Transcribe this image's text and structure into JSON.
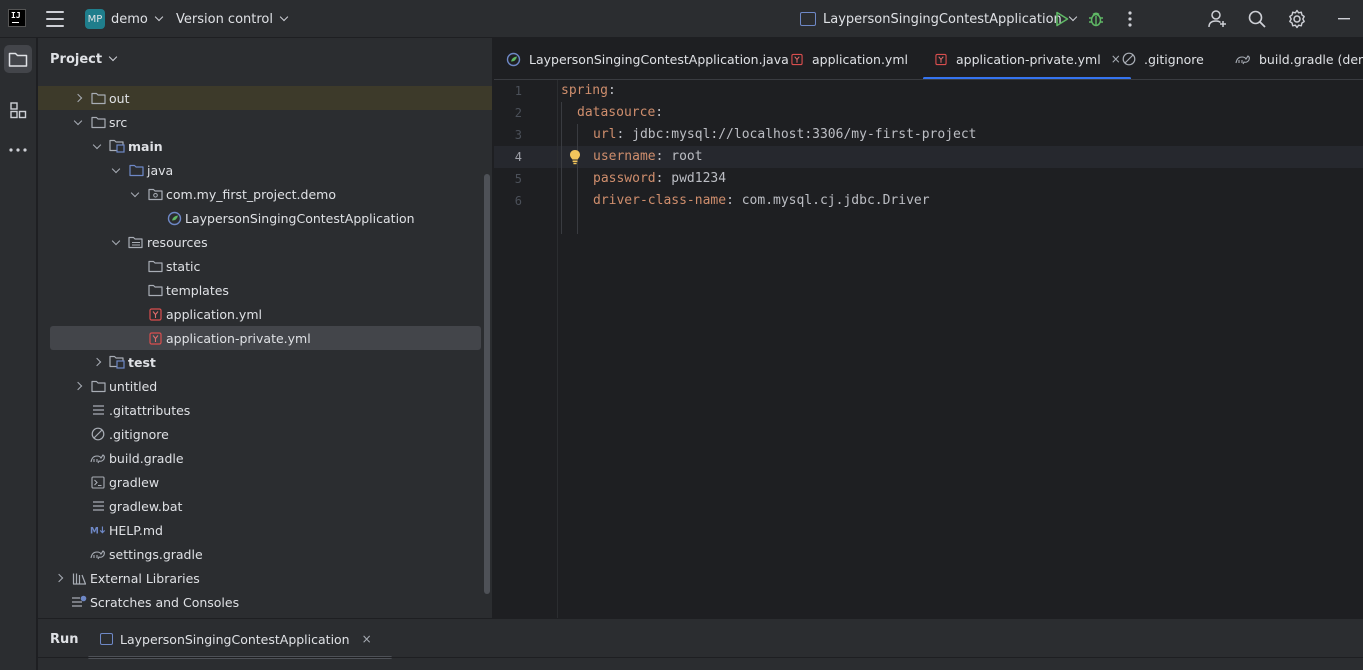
{
  "titlebar": {
    "project_badge": "MP",
    "project_name": "demo",
    "vcs_label": "Version control",
    "run_config": "LaypersonSingingContestApplication"
  },
  "project_panel": {
    "title": "Project",
    "tree": [
      {
        "label": "out",
        "type": "folder",
        "depth": 1,
        "expanded": false
      },
      {
        "label": "src",
        "type": "folder",
        "depth": 1,
        "expanded": true
      },
      {
        "label": "main",
        "type": "module-folder",
        "depth": 2,
        "expanded": true,
        "bold": true
      },
      {
        "label": "java",
        "type": "source-folder",
        "depth": 3,
        "expanded": true
      },
      {
        "label": "com.my_first_project.demo",
        "type": "package",
        "depth": 4,
        "expanded": true
      },
      {
        "label": "LaypersonSingingContestApplication",
        "type": "spring-class",
        "depth": 5
      },
      {
        "label": "resources",
        "type": "resources-folder",
        "depth": 3,
        "expanded": true
      },
      {
        "label": "static",
        "type": "folder",
        "depth": 4
      },
      {
        "label": "templates",
        "type": "folder",
        "depth": 4
      },
      {
        "label": "application.yml",
        "type": "yml",
        "depth": 4
      },
      {
        "label": "application-private.yml",
        "type": "yml",
        "depth": 4,
        "selected": true
      },
      {
        "label": "test",
        "type": "module-folder",
        "depth": 2,
        "expanded": false,
        "bold": true
      },
      {
        "label": "untitled",
        "type": "folder",
        "depth": 1,
        "expanded": false
      },
      {
        "label": ".gitattributes",
        "type": "text",
        "depth": 1
      },
      {
        "label": ".gitignore",
        "type": "ignore",
        "depth": 1
      },
      {
        "label": "build.gradle",
        "type": "gradle",
        "depth": 1
      },
      {
        "label": "gradlew",
        "type": "shell",
        "depth": 1
      },
      {
        "label": "gradlew.bat",
        "type": "text",
        "depth": 1
      },
      {
        "label": "HELP.md",
        "type": "markdown",
        "depth": 1
      },
      {
        "label": "settings.gradle",
        "type": "gradle",
        "depth": 1
      },
      {
        "label": "External Libraries",
        "type": "libraries",
        "depth": 0,
        "expanded": false
      },
      {
        "label": "Scratches and Consoles",
        "type": "scratches",
        "depth": 0
      }
    ]
  },
  "editor": {
    "tabs": [
      {
        "label": "LaypersonSingingContestApplication.java",
        "type": "spring-class",
        "active": false
      },
      {
        "label": "application.yml",
        "type": "yml",
        "active": false
      },
      {
        "label": "application-private.yml",
        "type": "yml",
        "active": true,
        "close": "×"
      },
      {
        "label": ".gitignore",
        "type": "ignore",
        "active": false
      },
      {
        "label": "build.gradle (demo)",
        "type": "gradle",
        "active": false
      }
    ],
    "current_line": 4,
    "lines": [
      {
        "num": "1",
        "key": "spring",
        "sep": ":",
        "value": ""
      },
      {
        "num": "2",
        "key": "datasource",
        "sep": ":",
        "value": ""
      },
      {
        "num": "3",
        "key": "url",
        "sep": ":",
        "value": " jdbc:mysql://localhost:3306/my-first-project"
      },
      {
        "num": "4",
        "key": "username",
        "sep": ":",
        "value": " root"
      },
      {
        "num": "5",
        "key": "password",
        "sep": ":",
        "value": " pwd1234"
      },
      {
        "num": "6",
        "key": "driver-class-name",
        "sep": ":",
        "value": " com.mysql.cj.jdbc.Driver"
      }
    ]
  },
  "run_panel": {
    "title": "Run",
    "tab_label": "LaypersonSingingContestApplication",
    "tab_close": "×"
  },
  "colors": {
    "accent": "#3574f0",
    "yaml_key": "#cf8e6d",
    "run_green": "#5fb865"
  }
}
